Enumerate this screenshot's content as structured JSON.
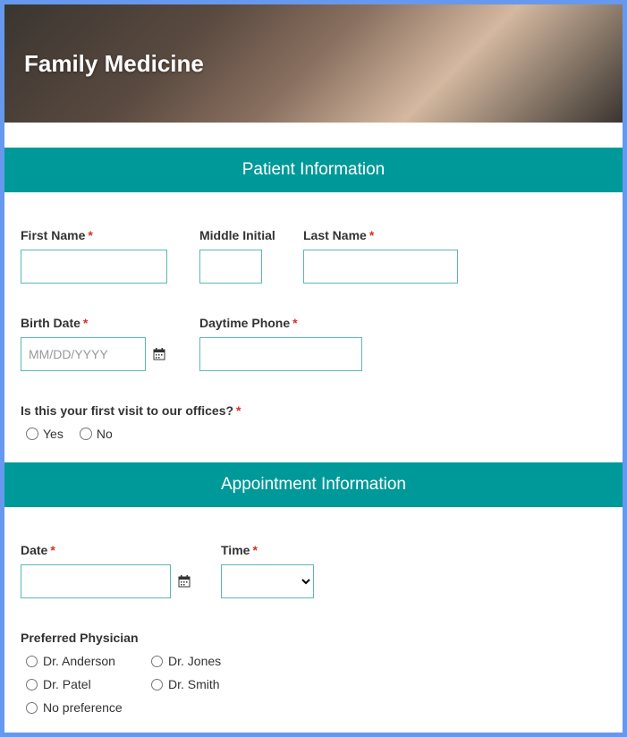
{
  "hero": {
    "title": "Family Medicine"
  },
  "section1": {
    "title": "Patient Information",
    "firstName": {
      "label": "First Name",
      "required": true
    },
    "middleInitial": {
      "label": "Middle Initial",
      "required": false
    },
    "lastName": {
      "label": "Last Name",
      "required": true
    },
    "birthDate": {
      "label": "Birth Date",
      "required": true,
      "placeholder": "MM/DD/YYYY"
    },
    "daytimePhone": {
      "label": "Daytime Phone",
      "required": true
    },
    "firstVisit": {
      "label": "Is this your first visit to our offices?",
      "required": true,
      "options": [
        "Yes",
        "No"
      ]
    }
  },
  "section2": {
    "title": "Appointment Information",
    "date": {
      "label": "Date",
      "required": true
    },
    "time": {
      "label": "Time",
      "required": true
    },
    "physician": {
      "label": "Preferred Physician",
      "options": [
        "Dr. Anderson",
        "Dr. Jones",
        "Dr. Patel",
        "Dr. Smith",
        "No preference"
      ]
    }
  },
  "asterisk": "*"
}
